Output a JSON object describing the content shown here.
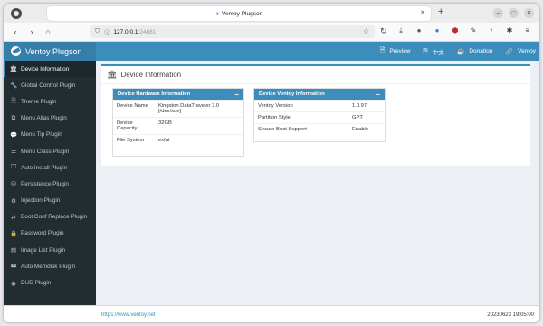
{
  "browser": {
    "tab_title": "Ventoy Plugson",
    "url_host": "127.0.0.1",
    "url_port": ":24681"
  },
  "app": {
    "brand": "Ventoy Plugson",
    "nav": {
      "preview": "Preview",
      "language": "中文",
      "donation": "Donation",
      "ventoy": "Ventoy"
    }
  },
  "sidebar": {
    "items": [
      {
        "label": "Device Information",
        "icon": "bank-icon",
        "glyph": "🏛"
      },
      {
        "label": "Global Control Plugin",
        "icon": "wrench-icon",
        "glyph": "🔧"
      },
      {
        "label": "Theme Plugin",
        "icon": "file-icon",
        "glyph": "🗎"
      },
      {
        "label": "Menu Alias Plugin",
        "icon": "copy-icon",
        "glyph": "⧉"
      },
      {
        "label": "Menu Tip Plugin",
        "icon": "comment-icon",
        "glyph": "💬"
      },
      {
        "label": "Menu Class Plugin",
        "icon": "list-icon",
        "glyph": "☰"
      },
      {
        "label": "Auto Install Plugin",
        "icon": "desktop-icon",
        "glyph": "🖵"
      },
      {
        "label": "Persistence Plugin",
        "icon": "database-icon",
        "glyph": "⛁"
      },
      {
        "label": "Injection Plugin",
        "icon": "cog-icon",
        "glyph": "⚙"
      },
      {
        "label": "Boot Conf Replace Plugin",
        "icon": "exchange-icon",
        "glyph": "⇄"
      },
      {
        "label": "Password Plugin",
        "icon": "lock-icon",
        "glyph": "🔒"
      },
      {
        "label": "Image List Plugin",
        "icon": "list-alt-icon",
        "glyph": "▤"
      },
      {
        "label": "Auto Memdisk Plugin",
        "icon": "hdd-icon",
        "glyph": "🖴"
      },
      {
        "label": "DUD Plugin",
        "icon": "disc-icon",
        "glyph": "◉"
      }
    ]
  },
  "content": {
    "title": "Device Information",
    "hardware": {
      "header": "Device Hardware Information",
      "rows": [
        {
          "key": "Device Name",
          "value": "Kingston DataTraveler 3.0 [/dev/sde]"
        },
        {
          "key": "Device Capacity",
          "value": "32GB"
        },
        {
          "key": "File System",
          "value": "exfat"
        }
      ]
    },
    "ventoy": {
      "header": "Device Ventoy Information",
      "rows": [
        {
          "key": "Ventoy Version",
          "value": "1.0.97"
        },
        {
          "key": "Partition Style",
          "value": "GPT"
        },
        {
          "key": "Secure Boot Support",
          "value": "Enable"
        }
      ]
    }
  },
  "footer": {
    "link": "https://www.ventoy.net",
    "version": "20230623 19:05:00"
  },
  "colors": {
    "accent": "#3c8dbc",
    "brand_bg": "#367fa9",
    "sidebar_bg": "#222d32"
  }
}
